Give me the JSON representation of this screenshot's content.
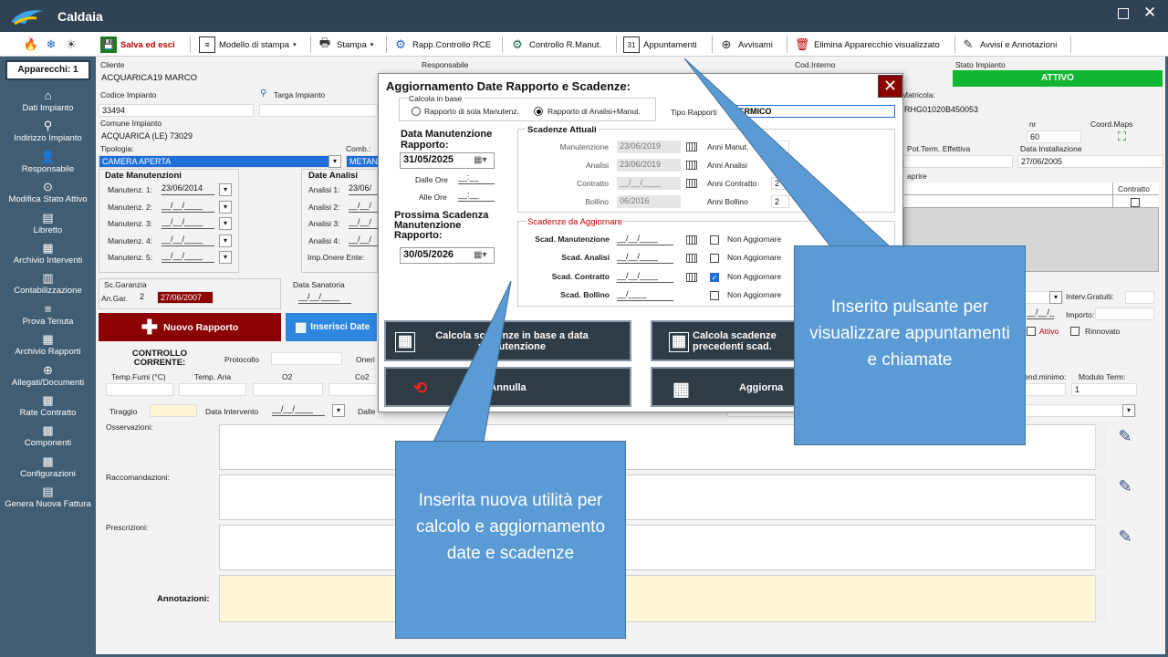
{
  "app": {
    "title": "Caldaia"
  },
  "toolbar": {
    "save": "Salva ed esci",
    "print_model": "Modello di stampa",
    "print": "Stampa",
    "rapp_rce": "Rapp.Controllo RCE",
    "controllo_manut": "Controllo R.Manut.",
    "appuntamenti": "Appuntamenti",
    "avvisami": "Avvisami",
    "elimina": "Elimina Apparecchio visualizzato",
    "avvisi": "Avvisi e Annotazioni"
  },
  "sidebar": {
    "apparecchi": "Apparecchi: 1",
    "items": [
      "Dati Impianto",
      "Indirizzo Impianto",
      "Responsabile",
      "Modifica Stato Attivo",
      "Libretto",
      "Archivio Interventi",
      "Contabilizzazione",
      "Prova Tenuta",
      "Archivio Rapporti",
      "Allegati/Documenti",
      "Rate Contratto",
      "Componenti",
      "Configurazioni",
      "Genera Nuova Fattura"
    ]
  },
  "form": {
    "cliente_lbl": "Cliente",
    "cliente": "ACQUARICA19 MARCO",
    "responsabile_lbl": "Responsabile",
    "cod_interno_lbl": "Cod.Interno",
    "stato_lbl": "Stato Impianto",
    "stato": "ATTIVO",
    "codice_lbl": "Codice Impianto",
    "codice": "33494",
    "targa_lbl": "Targa Impianto",
    "matricola_lbl": "Matricola:",
    "matricola": "RHG01020B450053",
    "comune_lbl": "Comune Impianto",
    "comune": "ACQUARICA (LE) 73029",
    "nr_lbl": "nr",
    "nr": "60",
    "coord_lbl": "Coord.Maps",
    "tipologia_lbl": "Tipologia:",
    "tipologia": "CAMERA APERTA",
    "comb_lbl": "Comb.:",
    "comb": "METAN",
    "pot_lbl": "Pot.Term. Effettiva",
    "install_lbl": "Data Installazione",
    "install": "27/06/2005",
    "date_manut_lbl": "Date Manutenzioni",
    "date_analisi_lbl": "Date Analisi",
    "manut_rows": [
      {
        "l": "Manutenz. 1:",
        "v": "23/06/2014"
      },
      {
        "l": "Manutenz. 2:",
        "v": "__/__/____"
      },
      {
        "l": "Manutenz. 3:",
        "v": "__/__/____"
      },
      {
        "l": "Manutenz. 4:",
        "v": "__/__/____"
      },
      {
        "l": "Manutenz. 5:",
        "v": "__/__/____"
      }
    ],
    "analisi_rows": [
      {
        "l": "Analisi 1:",
        "v": "23/06/"
      },
      {
        "l": "Analisi 2:",
        "v": "__/__/"
      },
      {
        "l": "Analisi 3:",
        "v": "__/__/"
      },
      {
        "l": "Analisi 4:",
        "v": "__/__/"
      }
    ],
    "imp_onere": "Imp.Onere Ente:",
    "aprire": "aprire",
    "contratto_col": "Contratto",
    "scgaranzia": "Sc.Garanzia",
    "angar_lbl": "An.Gar.",
    "angar": "2",
    "angar_date": "27/06/2007",
    "sanatoria": "Data Sanatoria",
    "sanatoria_v": "__/__/____",
    "nuovo_rapporto": "Nuovo Rapporto",
    "inserisci": "Inserisci Date",
    "interv_gratuiti": "Interv.Gratuiti:",
    "importo": "Importo:",
    "attivo": "Attivo",
    "rinnovato": "Rinnovato",
    "controllo": "CONTROLLO CORRENTE:",
    "protocollo": "Protocollo",
    "oneri": "Oneri",
    "temp_fumi": "Temp.Fumi (°C)",
    "temp_aria": "Temp. Aria",
    "o2": "O2",
    "co2": "Co2",
    "rend_min": "Rend.minimo:",
    "modulo": "Modulo Term:",
    "modulo_v": "1",
    "tiraggio": "Tiraggio",
    "data_int": "Data Intervento",
    "data_int_v": "__/__/____",
    "dalle": "Dalle",
    "osservazioni": "Osservazioni:",
    "raccomandazioni": "Raccomandazioni:",
    "prescrizioni": "Prescrizioni:",
    "annotazioni": "Annotazioni:"
  },
  "dialog": {
    "title": "Aggiornamento Date Rapporto e Scadenze:",
    "calcola_lbl": "Calcola in base",
    "radio1": "Rapporto di sola Manutenz.",
    "radio2": "Rapporto di Analisi+Manut.",
    "tipo_lbl": "Tipo Rapporti",
    "tipo": "TERMICO",
    "data_manut_lbl": "Data Manutenzione Rapporto:",
    "data_manut": "31/05/2025",
    "dalle_ore": "Dalle Ore",
    "alle_ore": "Alle Ore",
    "ore_v": "__:__",
    "prossima_lbl": "Prossima Scadenza Manutenzione Rapporto:",
    "prossima": "30/05/2026",
    "attuali_lbl": "Scadenze Attuali",
    "attuali": [
      {
        "l": "Manutenzione",
        "v": "23/06/2019",
        "al": "Anni Manut."
      },
      {
        "l": "Analisi",
        "v": "23/06/2019",
        "al": "Anni Analisi"
      },
      {
        "l": "Contratto",
        "v": "__/__/____",
        "al": "Anni Contratto",
        "n": "2"
      },
      {
        "l": "Bollino",
        "v": "06/2016",
        "al": "Anni Bollino",
        "n": "2"
      }
    ],
    "aggiornare_lbl": "Scadenze da Aggiornare",
    "aggiornare": [
      {
        "l": "Scad. Manutenzione",
        "v": "__/__/____",
        "c": "Non Aggiornare",
        "on": false
      },
      {
        "l": "Scad. Analisi",
        "v": "__/__/____",
        "c": "Non Aggiornare",
        "on": false
      },
      {
        "l": "Scad. Contratto",
        "v": "__/__/____",
        "c": "Non Aggiornare",
        "on": true
      },
      {
        "l": "Scad. Bollino",
        "v": "__/____",
        "c": "Non Aggiornare",
        "on": false
      }
    ],
    "btn_calc_base": "Calcola scadenze in base a data manutenzione",
    "btn_calc_prec": "Calcola scadenze precedenti scad.",
    "btn_annulla": "Annulla",
    "btn_aggiorna": "Aggiorna"
  },
  "callouts": {
    "right": "Inserito pulsante per visualizzare appuntamenti e chiamate",
    "bottom": "Inserita nuova utilità per calcolo e aggiornamento date e scadenze"
  },
  "colors": {
    "title_bar": "#2f4354",
    "sidebar": "#405d73",
    "stato_green": "#10b531",
    "nuovo_red": "#8b0000",
    "callout": "#5b9bd5"
  }
}
